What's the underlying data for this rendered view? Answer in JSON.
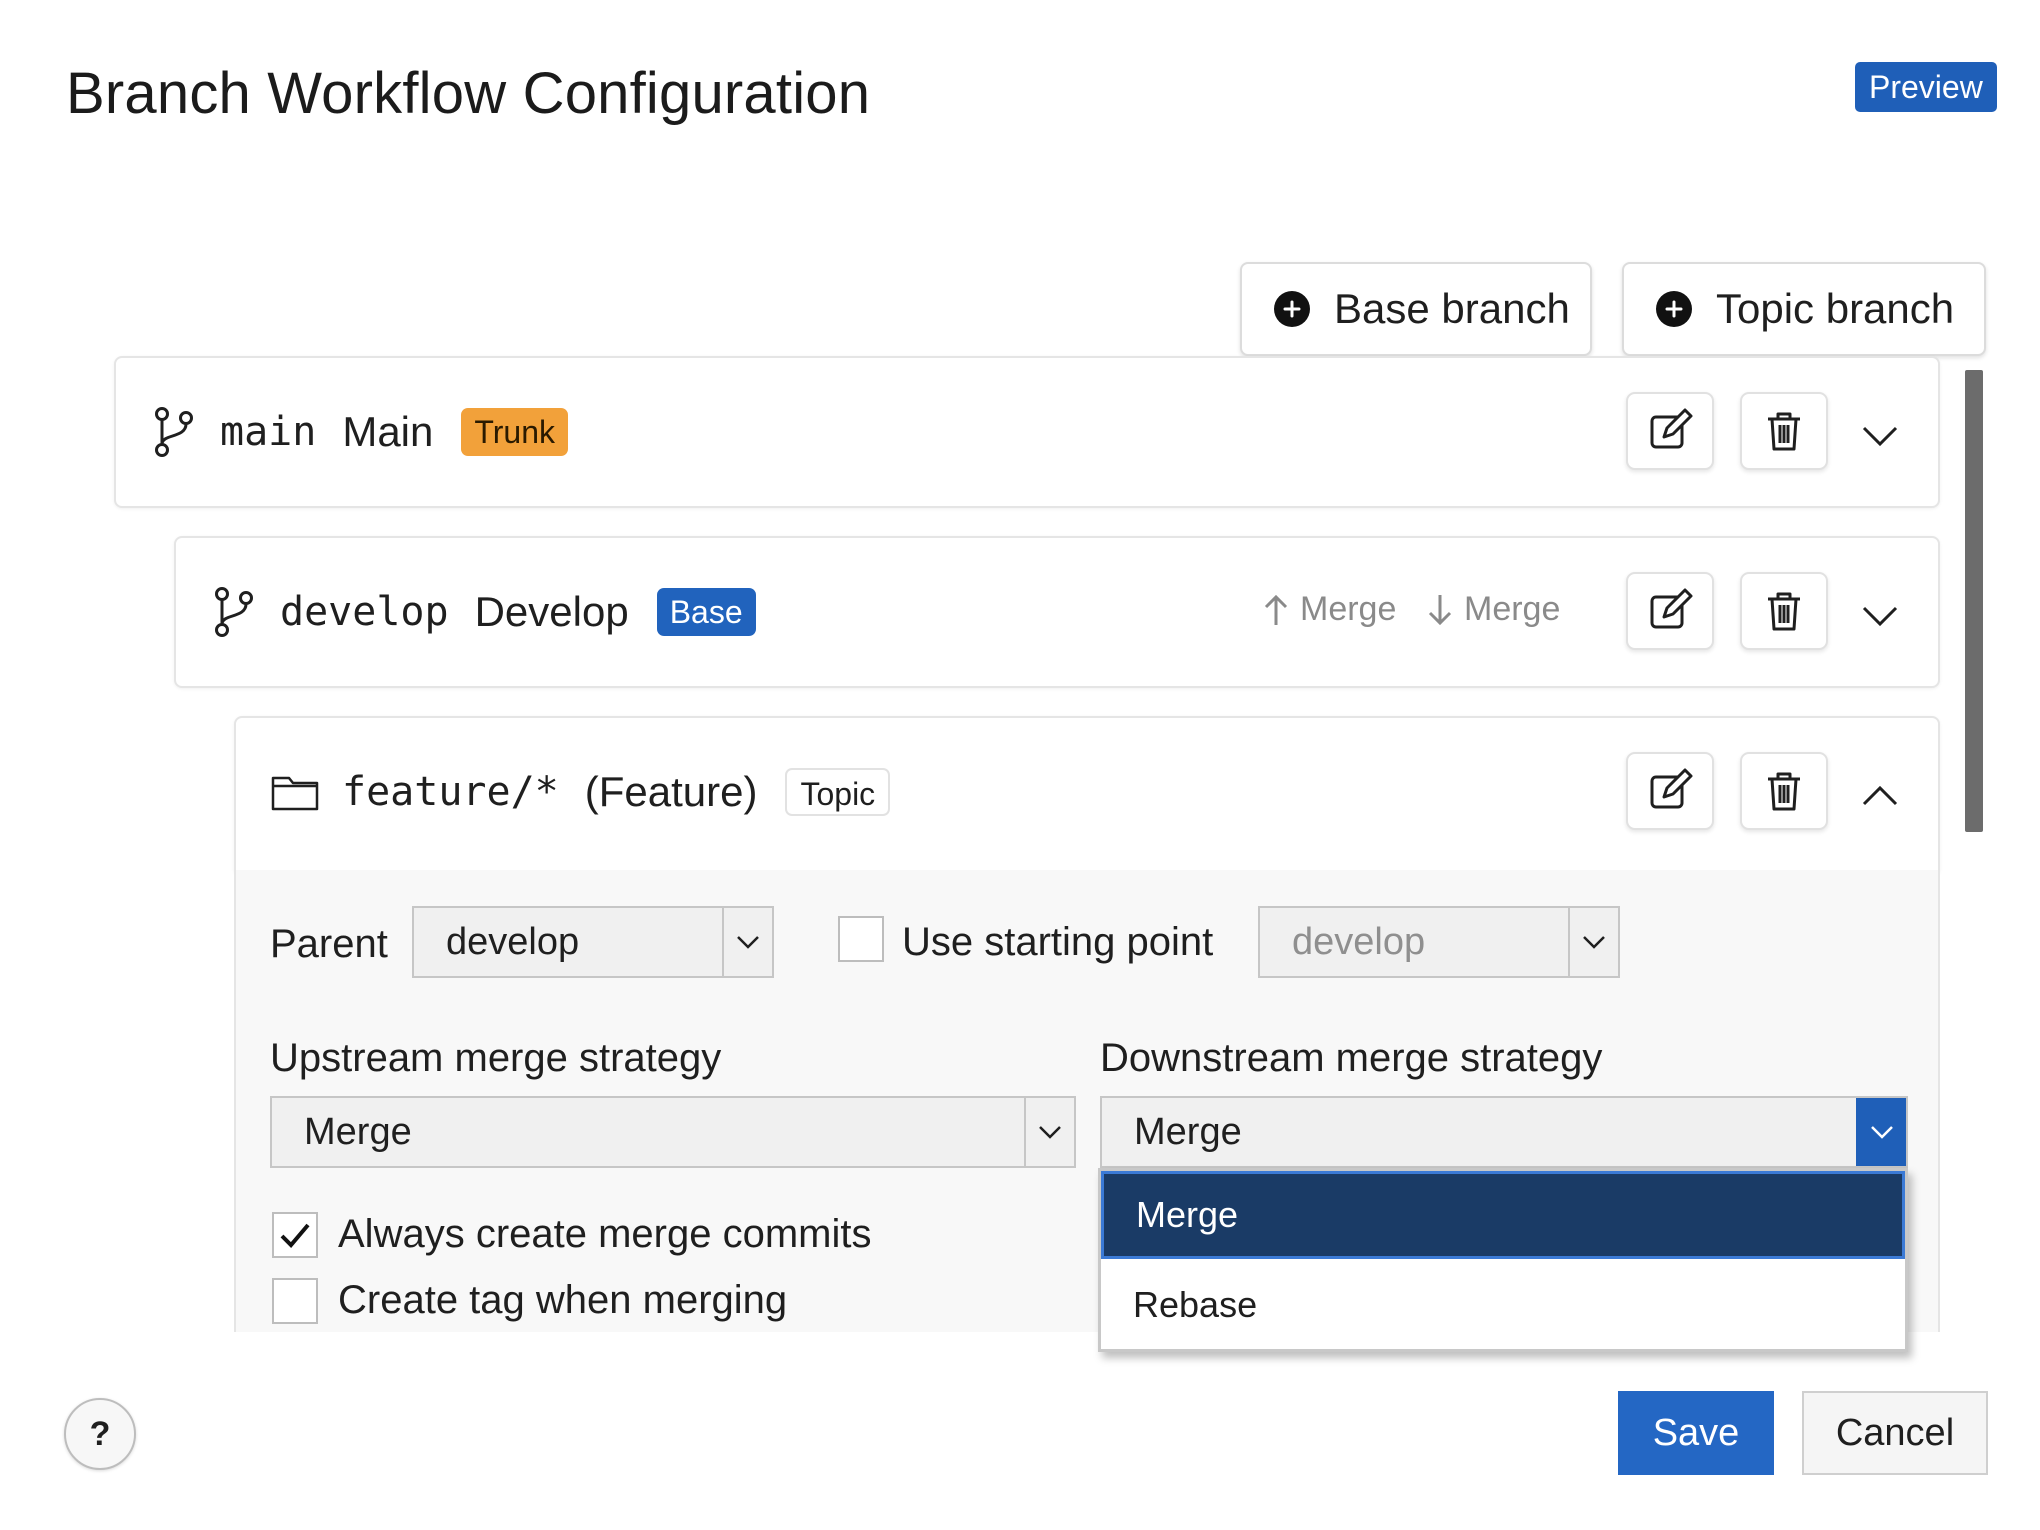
{
  "header": {
    "title": "Branch Workflow Configuration",
    "badge": "Preview"
  },
  "toolbar": {
    "add_base_label": "Base branch",
    "add_topic_label": "Topic branch"
  },
  "branches": [
    {
      "name": "main",
      "display": "Main",
      "tag": "Trunk",
      "expanded": false
    },
    {
      "name": "develop",
      "display": "Develop",
      "tag": "Base",
      "upstream_label": "Merge",
      "downstream_label": "Merge",
      "expanded": false
    },
    {
      "name": "feature/*",
      "display": "(Feature)",
      "tag": "Topic",
      "expanded": true
    }
  ],
  "settings": {
    "parent_label": "Parent",
    "parent_value": "develop",
    "use_starting_point_label": "Use starting point",
    "use_starting_point_checked": false,
    "starting_point_value": "develop",
    "upstream_label": "Upstream merge strategy",
    "upstream_value": "Merge",
    "downstream_label": "Downstream merge strategy",
    "downstream_value": "Merge",
    "downstream_options": [
      "Merge",
      "Rebase"
    ],
    "always_merge_commits_label": "Always create merge commits",
    "always_merge_commits_checked": true,
    "create_tag_label": "Create tag when merging",
    "create_tag_checked": false
  },
  "footer": {
    "help_label": "?",
    "save_label": "Save",
    "cancel_label": "Cancel"
  },
  "colors": {
    "accent": "#2467c4",
    "trunk": "#f2a13a",
    "base": "#2163bd",
    "dropdown_selected": "#1a3b66"
  }
}
